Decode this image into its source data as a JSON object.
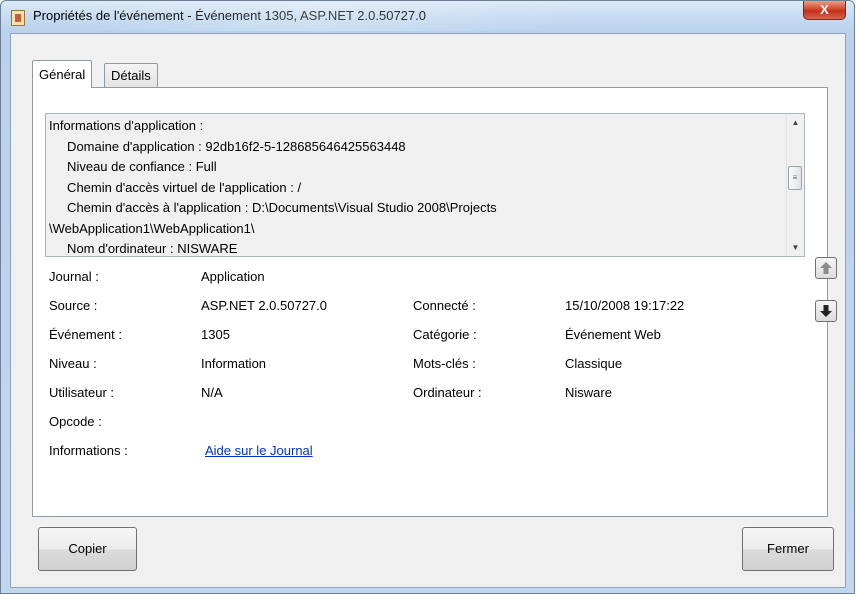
{
  "window": {
    "title": "Propriétés de l'événement - Événement 1305, ASP.NET 2.0.50727.0",
    "close_label": "X"
  },
  "tabs": [
    {
      "label": "Général",
      "active": true
    },
    {
      "label": "Détails",
      "active": false
    }
  ],
  "description": {
    "lines": [
      "Informations d'application :",
      "    Domaine d'application : 92db16f2-5-128685646425563448",
      "    Niveau de confiance : Full",
      "    Chemin d'accès virtuel de l'application : /",
      "    Chemin d'accès à l'application : D:\\Documents\\Visual Studio 2008\\Projects",
      "\\WebApplication1\\WebApplication1\\",
      "    Nom d'ordinateur : NISWARE"
    ]
  },
  "properties": {
    "journal": {
      "label": "Journal :",
      "value": "Application"
    },
    "source": {
      "label": "Source :",
      "value": "ASP.NET 2.0.50727.0"
    },
    "connecte": {
      "label": "Connecté :",
      "value": "15/10/2008 19:17:22"
    },
    "evenement": {
      "label": "Événement :",
      "value": "1305"
    },
    "categorie": {
      "label": "Catégorie :",
      "value": "Événement Web"
    },
    "niveau": {
      "label": "Niveau :",
      "value": "Information"
    },
    "motscles": {
      "label": "Mots-clés :",
      "value": "Classique"
    },
    "utilisateur": {
      "label": "Utilisateur :",
      "value": "N/A"
    },
    "ordinateur": {
      "label": "Ordinateur :",
      "value": "Nisware"
    },
    "opcode": {
      "label": "Opcode :",
      "value": ""
    },
    "informations": {
      "label": "Informations :",
      "link": "Aide sur le Journal"
    }
  },
  "nav": {
    "up_icon": "arrow-up-icon",
    "down_icon": "arrow-down-icon"
  },
  "buttons": {
    "copy": "Copier",
    "close": "Fermer"
  },
  "colors": {
    "link": "#0033cc",
    "close_button": "#c0301a",
    "titlebar": "#c6dbf1"
  }
}
